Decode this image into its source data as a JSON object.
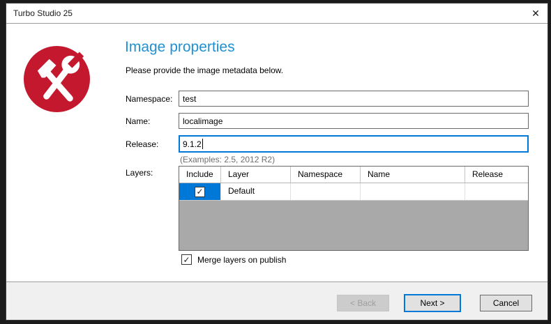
{
  "window": {
    "title": "Turbo Studio 25"
  },
  "icons": {
    "close": "✕",
    "check": "✓"
  },
  "header": {
    "title": "Image properties",
    "subtitle": "Please provide the image metadata below.",
    "accent_color": "#1f91d2",
    "icon_color": "#c4182f"
  },
  "form": {
    "namespace": {
      "label": "Namespace:",
      "value": "test"
    },
    "name": {
      "label": "Name:",
      "value": "localimage"
    },
    "release": {
      "label": "Release:",
      "value": "9.1.2",
      "hint": "(Examples: 2.5, 2012 R2)"
    },
    "layers_label": "Layers:"
  },
  "layers_table": {
    "columns": [
      "Include",
      "Layer",
      "Namespace",
      "Name",
      "Release"
    ],
    "row": {
      "include_checked": true,
      "layer": "Default",
      "namespace": "",
      "name": "",
      "release": ""
    },
    "selection_color": "#0078d7",
    "empty_area_color": "#a9a9a9"
  },
  "merge_checkbox": {
    "label": "Merge layers on publish",
    "checked": true
  },
  "buttons": {
    "back": "< Back",
    "next": "Next >",
    "cancel": "Cancel"
  }
}
